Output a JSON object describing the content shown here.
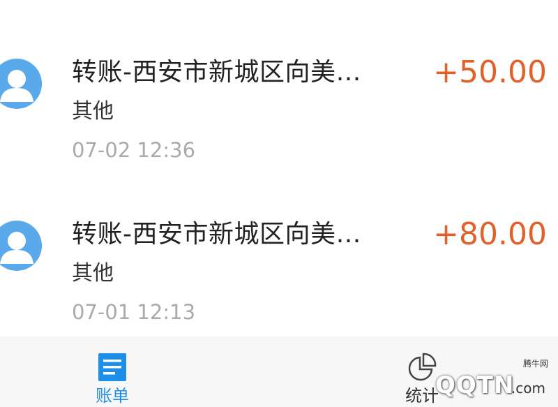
{
  "transactions": [
    {
      "title": "转账-西安市新城区向美…",
      "amount": "+50.00",
      "category": "其他",
      "time": "07-02  12:36"
    },
    {
      "title": "转账-西安市新城区向美…",
      "amount": "+80.00",
      "category": "其他",
      "time": "07-01  12:13"
    }
  ],
  "tabbar": {
    "bills_label": "账单",
    "stats_label": "统计",
    "active_color": "#1e8fe8"
  },
  "watermark": {
    "site_cn": "腾牛网",
    "logo": "QQTN",
    "suffix": ".com"
  },
  "colors": {
    "amount": "#e0612a",
    "avatar": "#5aa9ea"
  }
}
